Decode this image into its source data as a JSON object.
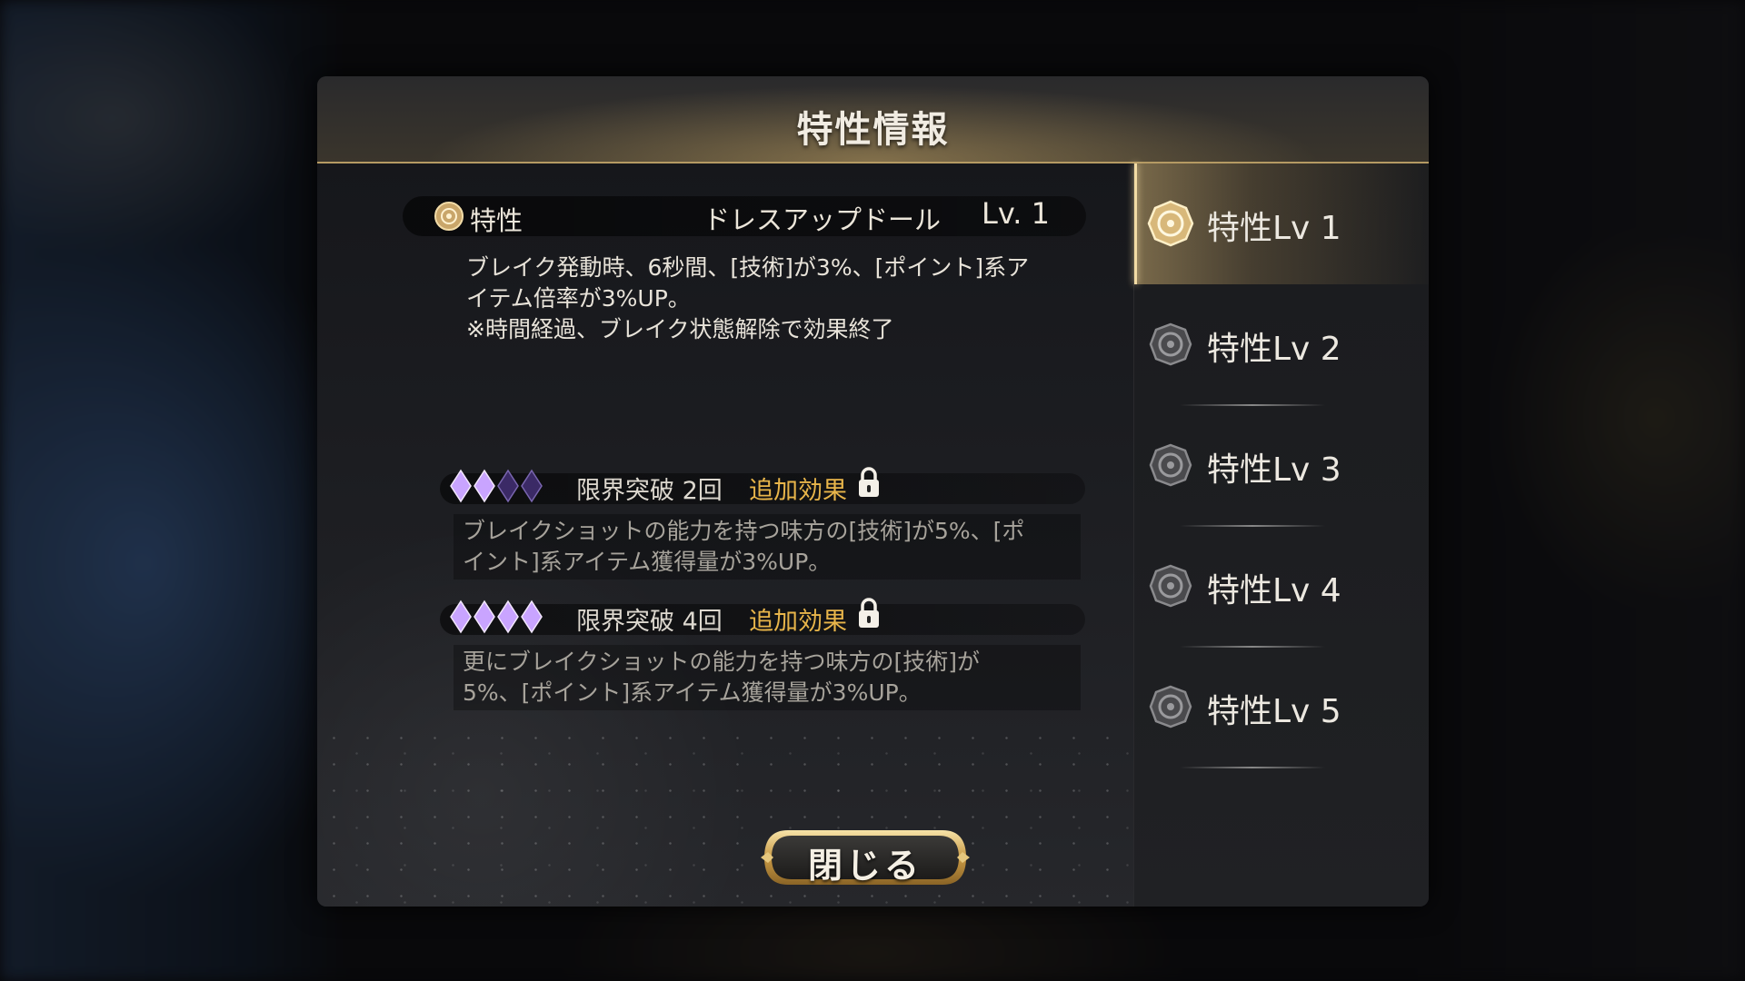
{
  "dialog": {
    "title": "特性情報",
    "close_label": "閉じる"
  },
  "trait": {
    "label": "特性",
    "name": "ドレスアップドール",
    "level": "Lv. 1",
    "description": "ブレイク発動時、6秒間、[技術]が3%、[ポイント]系ア\nイテム倍率が3%UP。\n※時間経過、ブレイク状態解除で効果終了"
  },
  "limit_breaks": [
    {
      "label": "限界突破 2回",
      "extra_label": "追加効果",
      "filled_diamonds": 2,
      "total_diamonds": 4,
      "locked": true,
      "description": "ブレイクショットの能力を持つ味方の[技術]が5%、[ポ\nイント]系アイテム獲得量が3%UP。"
    },
    {
      "label": "限界突破 4回",
      "extra_label": "追加効果",
      "filled_diamonds": 4,
      "total_diamonds": 4,
      "locked": true,
      "description": "更にブレイクショットの能力を持つ味方の[技術]が\n5%、[ポイント]系アイテム獲得量が3%UP。"
    }
  ],
  "levels": [
    {
      "label": "特性Lv 1",
      "active": true
    },
    {
      "label": "特性Lv 2",
      "active": false
    },
    {
      "label": "特性Lv 3",
      "active": false
    },
    {
      "label": "特性Lv 4",
      "active": false
    },
    {
      "label": "特性Lv 5",
      "active": false
    }
  ],
  "colors": {
    "accent_gold": "#e8b54a",
    "diamond_filled": "#c9a4ff",
    "diamond_empty": "#3b2a66"
  }
}
